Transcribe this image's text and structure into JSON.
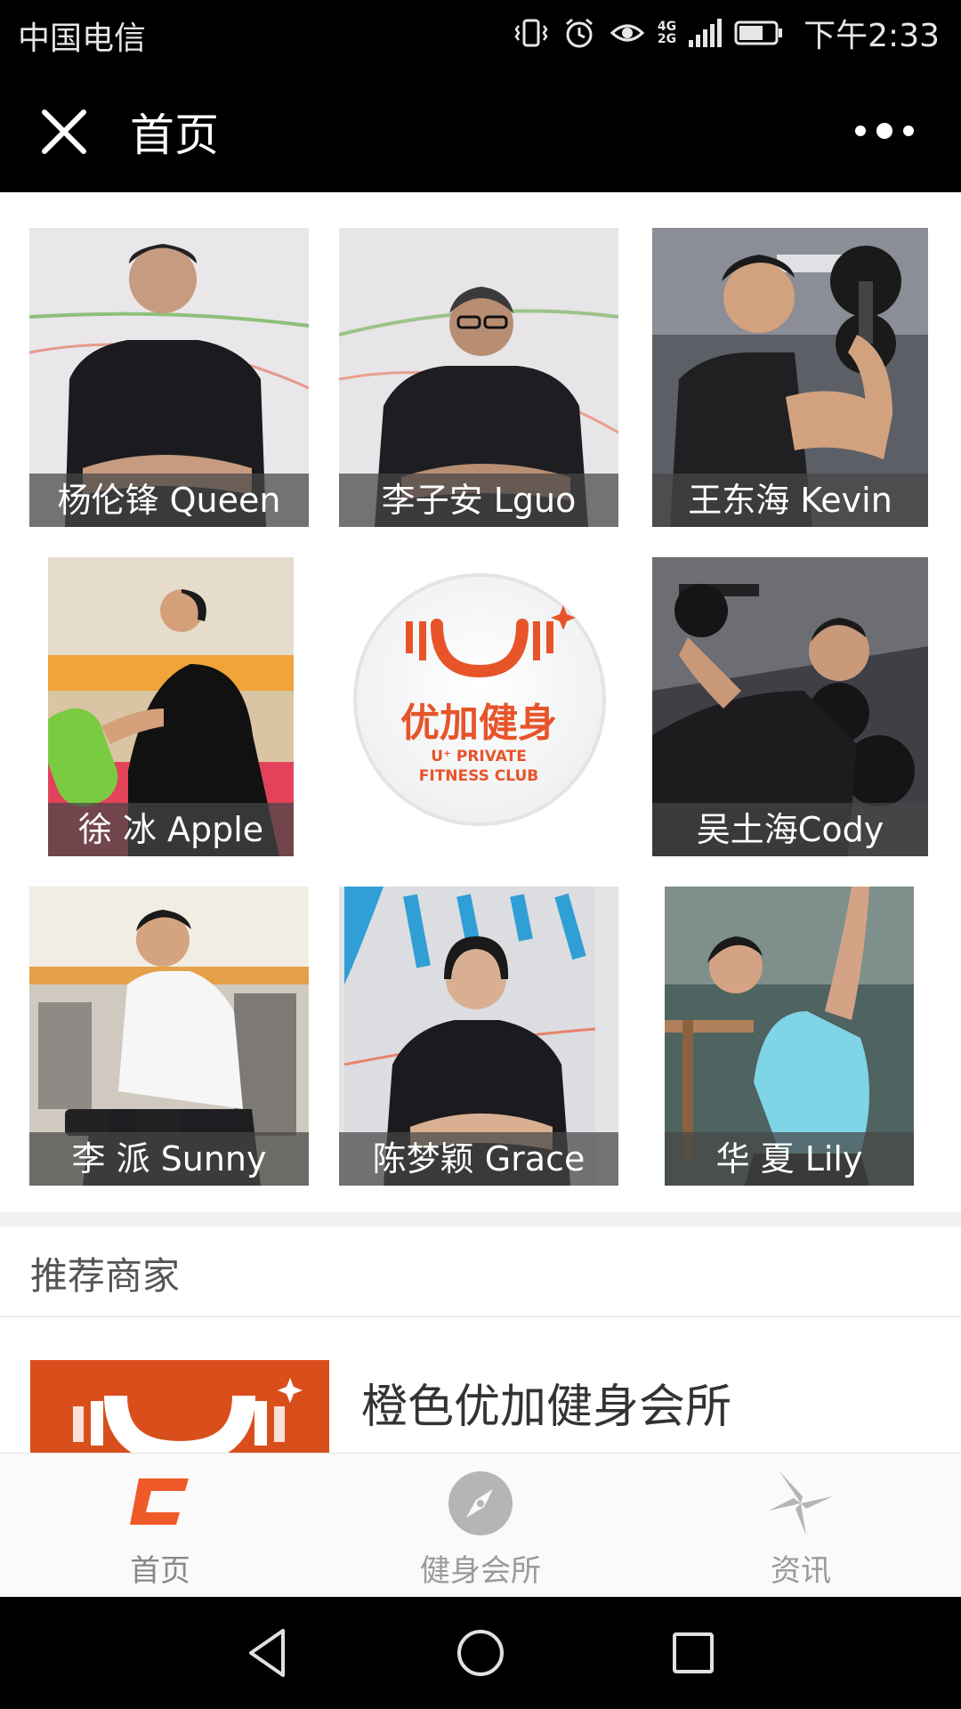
{
  "status_bar": {
    "carrier": "中国电信",
    "network": "4G",
    "network_alt": "2G",
    "time": "下午2:33"
  },
  "nav": {
    "title": "首页"
  },
  "trainers": [
    {
      "name": "杨伦锋 Queen"
    },
    {
      "name": "李子安 Lguo"
    },
    {
      "name": "王东海 Kevin"
    },
    {
      "name": "徐 冰 Apple"
    },
    {
      "name": "吴土海Cody"
    },
    {
      "name": "李 派 Sunny"
    },
    {
      "name": "陈梦颖 Grace"
    },
    {
      "name": "华 夏 Lily"
    }
  ],
  "logo": {
    "brand_cn": "优加健身",
    "brand_en_1": "U⁺ PRIVATE",
    "brand_en_2": "FITNESS CLUB",
    "color": "#e8542a"
  },
  "recommend": {
    "title": "推荐商家",
    "merchant_name": "橙色优加健身会所"
  },
  "tabs": [
    {
      "label": "首页",
      "icon": "home-icon"
    },
    {
      "label": "健身会所",
      "icon": "compass-icon"
    },
    {
      "label": "资讯",
      "icon": "pinwheel-icon"
    }
  ],
  "colors": {
    "accent": "#f05a28",
    "bar_black": "#000000"
  }
}
